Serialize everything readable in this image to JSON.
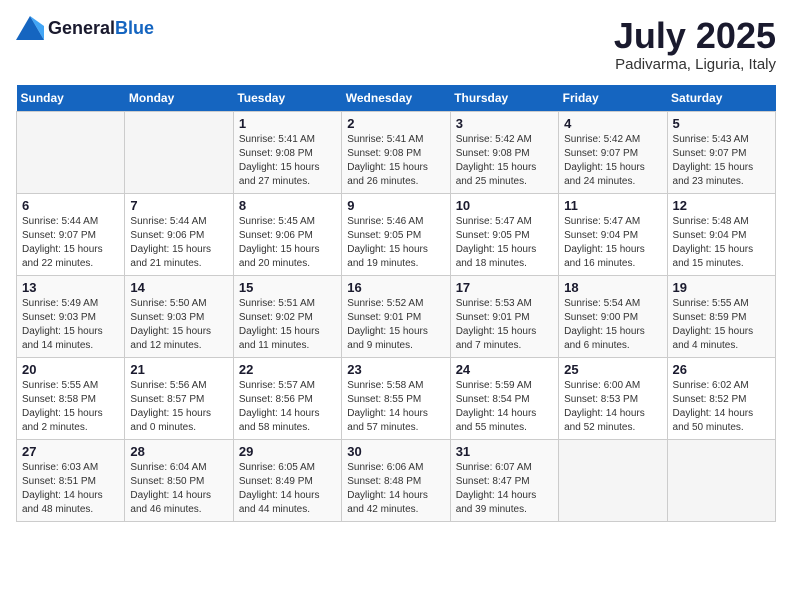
{
  "logo": {
    "general": "General",
    "blue": "Blue"
  },
  "title": "July 2025",
  "subtitle": "Padivarma, Liguria, Italy",
  "weekdays": [
    "Sunday",
    "Monday",
    "Tuesday",
    "Wednesday",
    "Thursday",
    "Friday",
    "Saturday"
  ],
  "weeks": [
    [
      {
        "day": "",
        "info": ""
      },
      {
        "day": "",
        "info": ""
      },
      {
        "day": "1",
        "info": "Sunrise: 5:41 AM\nSunset: 9:08 PM\nDaylight: 15 hours\nand 27 minutes."
      },
      {
        "day": "2",
        "info": "Sunrise: 5:41 AM\nSunset: 9:08 PM\nDaylight: 15 hours\nand 26 minutes."
      },
      {
        "day": "3",
        "info": "Sunrise: 5:42 AM\nSunset: 9:08 PM\nDaylight: 15 hours\nand 25 minutes."
      },
      {
        "day": "4",
        "info": "Sunrise: 5:42 AM\nSunset: 9:07 PM\nDaylight: 15 hours\nand 24 minutes."
      },
      {
        "day": "5",
        "info": "Sunrise: 5:43 AM\nSunset: 9:07 PM\nDaylight: 15 hours\nand 23 minutes."
      }
    ],
    [
      {
        "day": "6",
        "info": "Sunrise: 5:44 AM\nSunset: 9:07 PM\nDaylight: 15 hours\nand 22 minutes."
      },
      {
        "day": "7",
        "info": "Sunrise: 5:44 AM\nSunset: 9:06 PM\nDaylight: 15 hours\nand 21 minutes."
      },
      {
        "day": "8",
        "info": "Sunrise: 5:45 AM\nSunset: 9:06 PM\nDaylight: 15 hours\nand 20 minutes."
      },
      {
        "day": "9",
        "info": "Sunrise: 5:46 AM\nSunset: 9:05 PM\nDaylight: 15 hours\nand 19 minutes."
      },
      {
        "day": "10",
        "info": "Sunrise: 5:47 AM\nSunset: 9:05 PM\nDaylight: 15 hours\nand 18 minutes."
      },
      {
        "day": "11",
        "info": "Sunrise: 5:47 AM\nSunset: 9:04 PM\nDaylight: 15 hours\nand 16 minutes."
      },
      {
        "day": "12",
        "info": "Sunrise: 5:48 AM\nSunset: 9:04 PM\nDaylight: 15 hours\nand 15 minutes."
      }
    ],
    [
      {
        "day": "13",
        "info": "Sunrise: 5:49 AM\nSunset: 9:03 PM\nDaylight: 15 hours\nand 14 minutes."
      },
      {
        "day": "14",
        "info": "Sunrise: 5:50 AM\nSunset: 9:03 PM\nDaylight: 15 hours\nand 12 minutes."
      },
      {
        "day": "15",
        "info": "Sunrise: 5:51 AM\nSunset: 9:02 PM\nDaylight: 15 hours\nand 11 minutes."
      },
      {
        "day": "16",
        "info": "Sunrise: 5:52 AM\nSunset: 9:01 PM\nDaylight: 15 hours\nand 9 minutes."
      },
      {
        "day": "17",
        "info": "Sunrise: 5:53 AM\nSunset: 9:01 PM\nDaylight: 15 hours\nand 7 minutes."
      },
      {
        "day": "18",
        "info": "Sunrise: 5:54 AM\nSunset: 9:00 PM\nDaylight: 15 hours\nand 6 minutes."
      },
      {
        "day": "19",
        "info": "Sunrise: 5:55 AM\nSunset: 8:59 PM\nDaylight: 15 hours\nand 4 minutes."
      }
    ],
    [
      {
        "day": "20",
        "info": "Sunrise: 5:55 AM\nSunset: 8:58 PM\nDaylight: 15 hours\nand 2 minutes."
      },
      {
        "day": "21",
        "info": "Sunrise: 5:56 AM\nSunset: 8:57 PM\nDaylight: 15 hours\nand 0 minutes."
      },
      {
        "day": "22",
        "info": "Sunrise: 5:57 AM\nSunset: 8:56 PM\nDaylight: 14 hours\nand 58 minutes."
      },
      {
        "day": "23",
        "info": "Sunrise: 5:58 AM\nSunset: 8:55 PM\nDaylight: 14 hours\nand 57 minutes."
      },
      {
        "day": "24",
        "info": "Sunrise: 5:59 AM\nSunset: 8:54 PM\nDaylight: 14 hours\nand 55 minutes."
      },
      {
        "day": "25",
        "info": "Sunrise: 6:00 AM\nSunset: 8:53 PM\nDaylight: 14 hours\nand 52 minutes."
      },
      {
        "day": "26",
        "info": "Sunrise: 6:02 AM\nSunset: 8:52 PM\nDaylight: 14 hours\nand 50 minutes."
      }
    ],
    [
      {
        "day": "27",
        "info": "Sunrise: 6:03 AM\nSunset: 8:51 PM\nDaylight: 14 hours\nand 48 minutes."
      },
      {
        "day": "28",
        "info": "Sunrise: 6:04 AM\nSunset: 8:50 PM\nDaylight: 14 hours\nand 46 minutes."
      },
      {
        "day": "29",
        "info": "Sunrise: 6:05 AM\nSunset: 8:49 PM\nDaylight: 14 hours\nand 44 minutes."
      },
      {
        "day": "30",
        "info": "Sunrise: 6:06 AM\nSunset: 8:48 PM\nDaylight: 14 hours\nand 42 minutes."
      },
      {
        "day": "31",
        "info": "Sunrise: 6:07 AM\nSunset: 8:47 PM\nDaylight: 14 hours\nand 39 minutes."
      },
      {
        "day": "",
        "info": ""
      },
      {
        "day": "",
        "info": ""
      }
    ]
  ]
}
